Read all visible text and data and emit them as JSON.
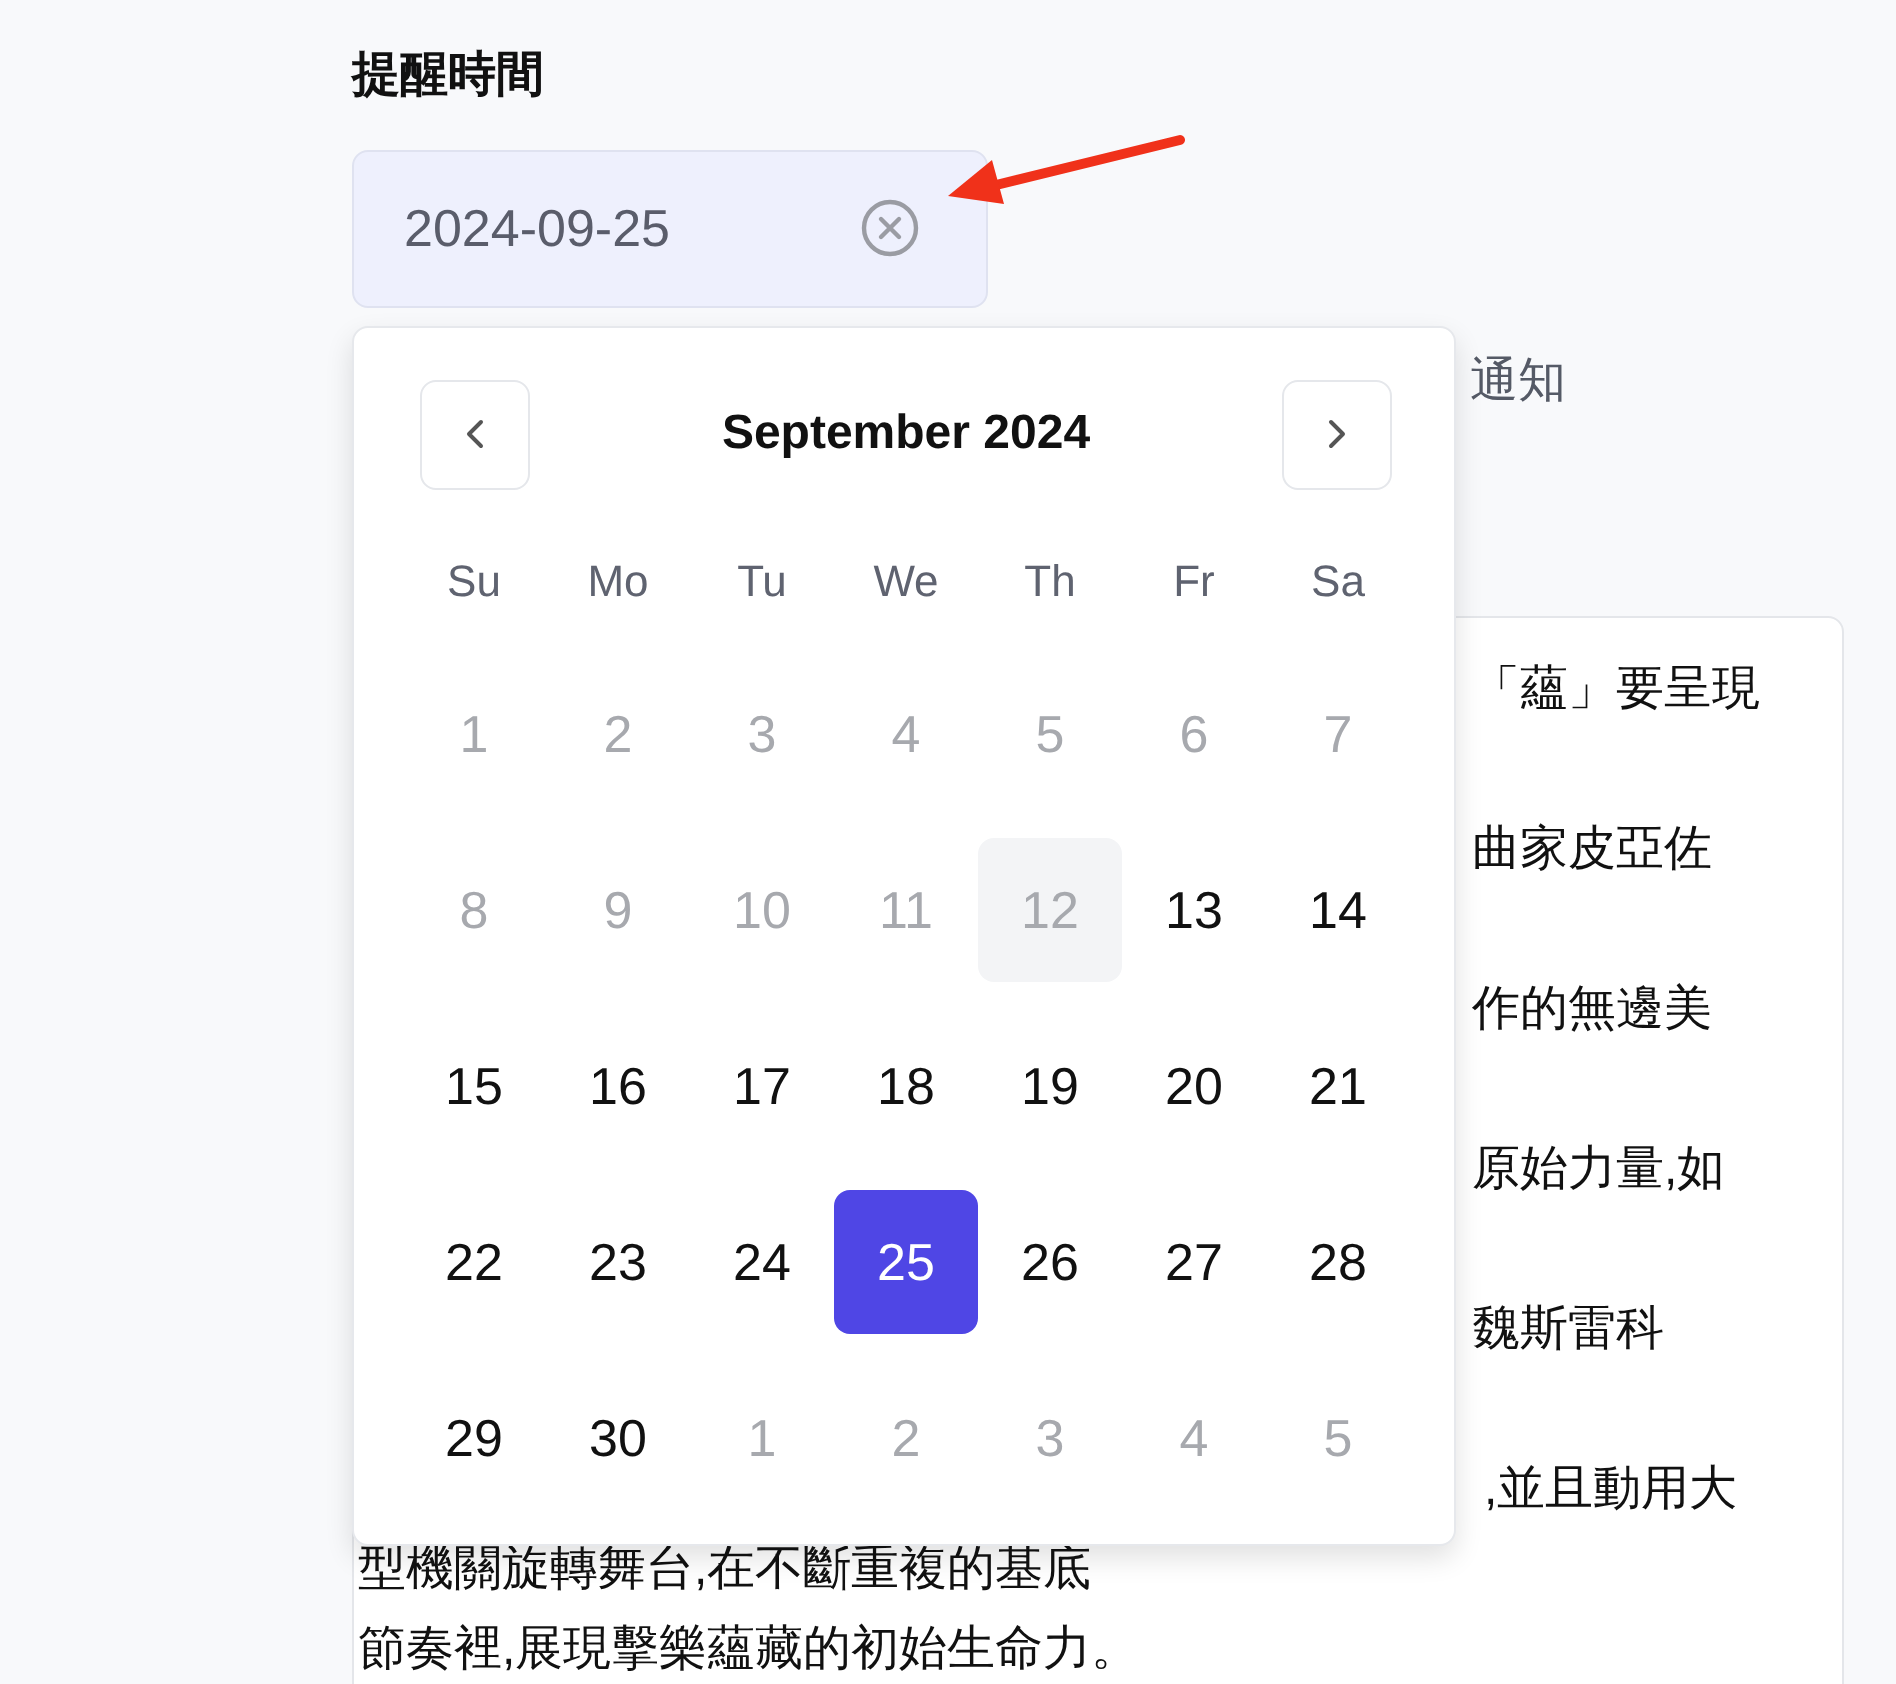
{
  "reminder": {
    "label": "提醒時間",
    "field": {
      "value": "2024-09-25"
    },
    "note": "通知"
  },
  "calendar": {
    "title": "September 2024",
    "weekdays": [
      "Su",
      "Mo",
      "Tu",
      "We",
      "Th",
      "Fr",
      "Sa"
    ],
    "days": [
      {
        "label": "1",
        "disabled": true,
        "today": false,
        "selected": false
      },
      {
        "label": "2",
        "disabled": true,
        "today": false,
        "selected": false
      },
      {
        "label": "3",
        "disabled": true,
        "today": false,
        "selected": false
      },
      {
        "label": "4",
        "disabled": true,
        "today": false,
        "selected": false
      },
      {
        "label": "5",
        "disabled": true,
        "today": false,
        "selected": false
      },
      {
        "label": "6",
        "disabled": true,
        "today": false,
        "selected": false
      },
      {
        "label": "7",
        "disabled": true,
        "today": false,
        "selected": false
      },
      {
        "label": "8",
        "disabled": true,
        "today": false,
        "selected": false
      },
      {
        "label": "9",
        "disabled": true,
        "today": false,
        "selected": false
      },
      {
        "label": "10",
        "disabled": true,
        "today": false,
        "selected": false
      },
      {
        "label": "11",
        "disabled": true,
        "today": false,
        "selected": false
      },
      {
        "label": "12",
        "disabled": true,
        "today": true,
        "selected": false
      },
      {
        "label": "13",
        "disabled": false,
        "today": false,
        "selected": false
      },
      {
        "label": "14",
        "disabled": false,
        "today": false,
        "selected": false
      },
      {
        "label": "15",
        "disabled": false,
        "today": false,
        "selected": false
      },
      {
        "label": "16",
        "disabled": false,
        "today": false,
        "selected": false
      },
      {
        "label": "17",
        "disabled": false,
        "today": false,
        "selected": false
      },
      {
        "label": "18",
        "disabled": false,
        "today": false,
        "selected": false
      },
      {
        "label": "19",
        "disabled": false,
        "today": false,
        "selected": false
      },
      {
        "label": "20",
        "disabled": false,
        "today": false,
        "selected": false
      },
      {
        "label": "21",
        "disabled": false,
        "today": false,
        "selected": false
      },
      {
        "label": "22",
        "disabled": false,
        "today": false,
        "selected": false
      },
      {
        "label": "23",
        "disabled": false,
        "today": false,
        "selected": false
      },
      {
        "label": "24",
        "disabled": false,
        "today": false,
        "selected": false
      },
      {
        "label": "25",
        "disabled": false,
        "today": false,
        "selected": true
      },
      {
        "label": "26",
        "disabled": false,
        "today": false,
        "selected": false
      },
      {
        "label": "27",
        "disabled": false,
        "today": false,
        "selected": false
      },
      {
        "label": "28",
        "disabled": false,
        "today": false,
        "selected": false
      },
      {
        "label": "29",
        "disabled": false,
        "today": false,
        "selected": false
      },
      {
        "label": "30",
        "disabled": false,
        "today": false,
        "selected": false
      },
      {
        "label": "1",
        "disabled": true,
        "today": false,
        "selected": false
      },
      {
        "label": "2",
        "disabled": true,
        "today": false,
        "selected": false
      },
      {
        "label": "3",
        "disabled": true,
        "today": false,
        "selected": false
      },
      {
        "label": "4",
        "disabled": true,
        "today": false,
        "selected": false
      },
      {
        "label": "5",
        "disabled": true,
        "today": false,
        "selected": false
      }
    ]
  },
  "article": {
    "paragraphs": [
      {
        "lines": [
          "「蘊」要呈現"
        ]
      },
      {
        "lines": [
          "曲家皮亞佐"
        ]
      },
      {
        "lines": [
          "作的無邊美"
        ]
      },
      {
        "lines": [
          "原始力量,如"
        ]
      },
      {
        "lines": [
          "魏斯雷科"
        ]
      },
      {
        "lines": [
          ",並且動用大",
          "型機關旋轉舞台,在不斷重複的基底",
          "節奏裡,展現擊樂蘊藏的初始生命力。"
        ]
      }
    ]
  }
}
